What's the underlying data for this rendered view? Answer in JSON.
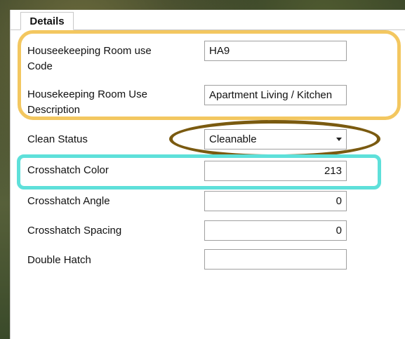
{
  "tabs": [
    {
      "label": "Details"
    }
  ],
  "fields": [
    {
      "label": "Houseekeeping Room use Code",
      "value": "HA9"
    },
    {
      "label": "Housekeeping Room Use Description",
      "value": "Apartment Living / Kitchen"
    },
    {
      "label": "Clean Status",
      "value": "Cleanable"
    },
    {
      "label": "Crosshatch Color",
      "value": "213"
    },
    {
      "label": "Crosshatch Angle",
      "value": "0"
    },
    {
      "label": "Crosshatch Spacing",
      "value": "0"
    },
    {
      "label": "Double Hatch",
      "value": ""
    }
  ],
  "highlight_colors": {
    "yellow": "#f3c760",
    "brown": "#7a5a10",
    "cyan": "#5ee0da"
  }
}
